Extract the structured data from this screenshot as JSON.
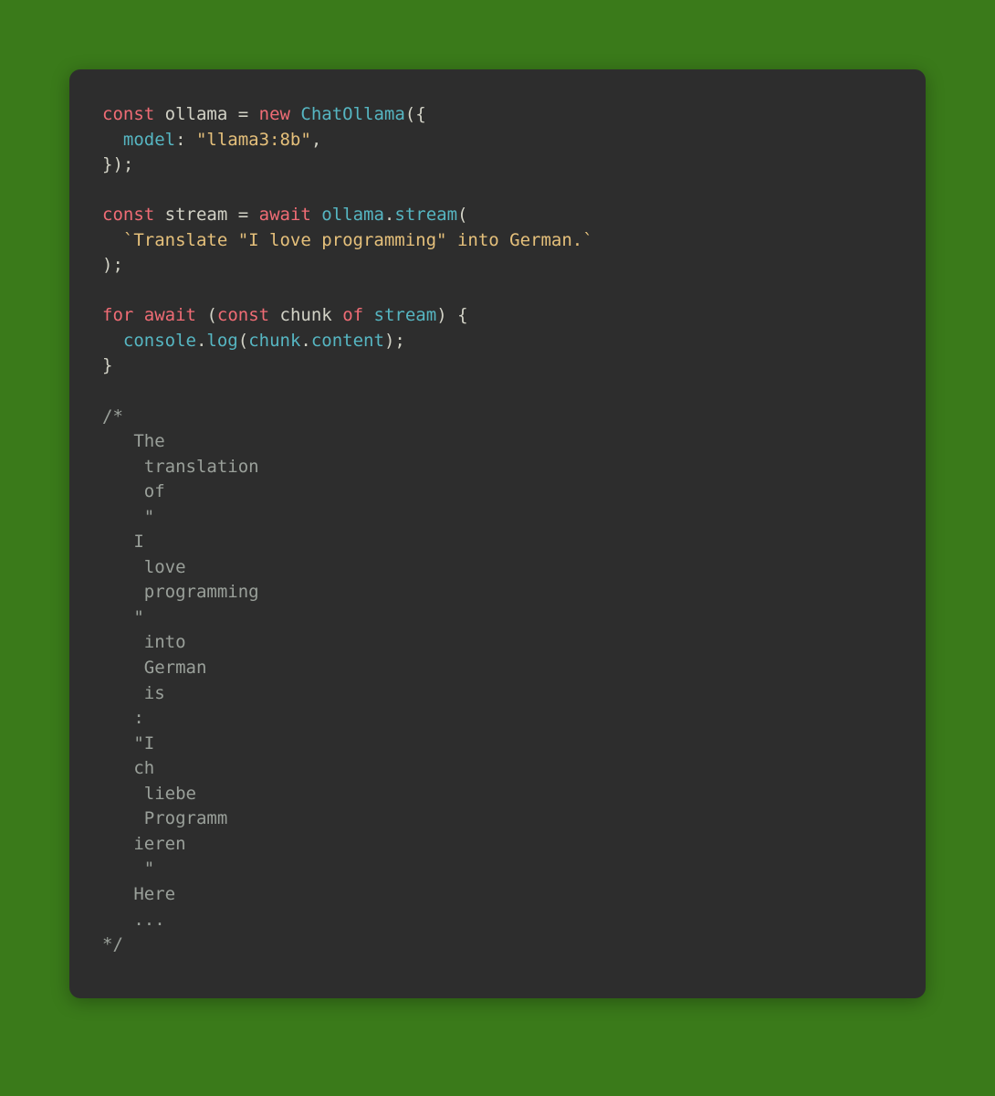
{
  "colors": {
    "pageBg": "#3a7a1a",
    "codeBg": "#2d2d2d",
    "default": "#d2d2c6",
    "keywordDecl": "#f06c75",
    "keywordOp": "#f06c75",
    "classname": "#56b6c2",
    "method": "#56b6c2",
    "prop": "#56b6c2",
    "string": "#e5c07b",
    "comment": "#9aa09a"
  },
  "tokens": {
    "const1": "const",
    "ollamaVar": "ollama",
    "eq1": " = ",
    "new": "new",
    "sp": " ",
    "ChatOllama": "ChatOllama",
    "openParen1": "(",
    "openBrace1": "{",
    "nl": "\n",
    "indent": "  ",
    "modelKey": "model",
    "colon": ": ",
    "modelVal": "\"llama3:8b\"",
    "comma": ",",
    "closeBrace1": "}",
    "closeParen1": ")",
    "semi": ";",
    "const2": "const",
    "streamVar": "stream",
    "eq2": " = ",
    "await1": "await",
    "ollamaRef": "ollama",
    "dot": ".",
    "streamMethod": "stream",
    "openParen2": "(",
    "templateStr": "`Translate \"I love programming\" into German.`",
    "closeParen2": ")",
    "for": "for",
    "await2": "await",
    "openParen3": "(",
    "const3": "const",
    "chunkVar": "chunk",
    "of": "of",
    "streamRef": "stream",
    "closeParen3": ")",
    "openBrace2": " {",
    "consoleRef": "console",
    "logMethod": "log",
    "openParen4": "(",
    "chunkRef": "chunk",
    "contentProp": "content",
    "closeParen4": ")",
    "closeBrace2": "}",
    "commentBlock": "/*\n   The\n    translation\n    of\n    \"\n   I\n    love\n    programming\n   \"\n    into\n    German\n    is\n   :\n   \"I\n   ch\n    liebe\n    Programm\n   ieren\n    \"\n   Here\n   ...\n*/"
  }
}
